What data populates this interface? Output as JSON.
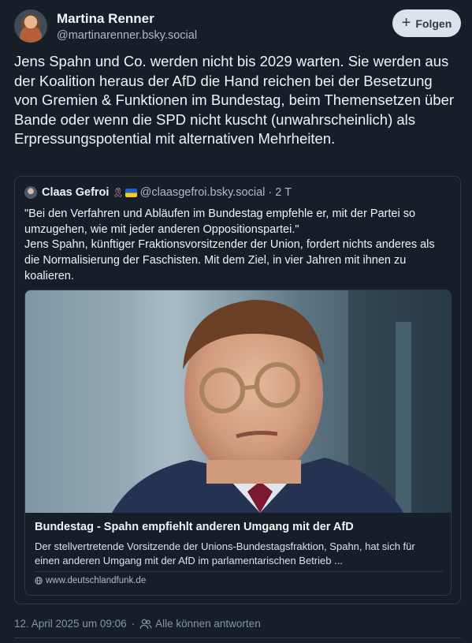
{
  "author": {
    "name": "Martina Renner",
    "handle": "@martinarenner.bsky.social"
  },
  "follow_button": {
    "icon": "+",
    "label": "Folgen"
  },
  "post": {
    "text": "Jens Spahn und Co. werden nicht bis 2029 warten. Sie werden aus der Koalition heraus der AfD die Hand reichen bei der Besetzung von Gremien & Funktionen im Bundestag, beim Themensetzen über Bande oder wenn die SPD nicht kuscht (unwahrscheinlich) als Erpressungspotential mit alternativen Mehrheiten."
  },
  "quote": {
    "name": "Claas Gefroi",
    "emoji": "🎗",
    "handle": "@claasgefroi.bsky.social · 2 T",
    "text": "\"Bei den Verfahren und Abläufen im Bundestag empfehle er, mit der Partei so umzugehen, wie mit jeder anderen Oppositionspartei.\"\nJens Spahn, künftiger Fraktionsvorsitzender der Union, fordert nichts anderes als die Normalisierung der Faschisten. Mit dem Ziel, in vier Jahren mit ihnen zu koalieren.",
    "card": {
      "title": "Bundestag - Spahn empfiehlt anderen Umgang mit der AfD",
      "description": "Der stellvertretende Vorsitzende der Unions-Bundestagsfraktion, Spahn, hat sich für einen anderen Umgang mit der AfD im parlamentarischen Betrieb ...",
      "domain": "www.deutschlandfunk.de"
    }
  },
  "footer": {
    "timestamp": "12. April 2025 um 09:06",
    "reply_setting": "Alle können antworten"
  },
  "colors": {
    "background": "#161e27",
    "border": "#2e3a47",
    "muted_text": "#aebbc9",
    "follow_button_bg": "#dce2ea"
  }
}
